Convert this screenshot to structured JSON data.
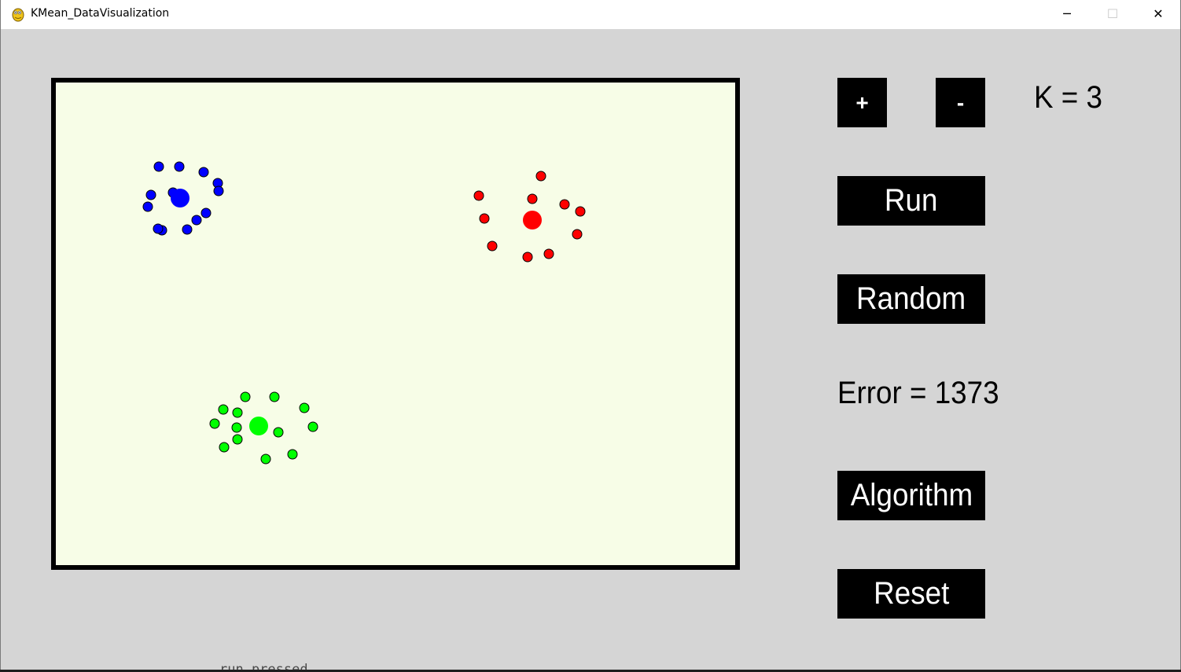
{
  "window": {
    "title": "KMean_DataVisualization",
    "minimize_glyph": "─",
    "maximize_glyph": "☐",
    "close_glyph": "✕",
    "app_icon": "pygame-snake-icon"
  },
  "controls": {
    "plus_label": "+",
    "minus_label": "-",
    "k_text": "K = 3",
    "run_label": "Run",
    "random_label": "Random",
    "error_text": "Error = 1373",
    "algorithm_label": "Algorithm",
    "reset_label": "Reset"
  },
  "console": {
    "text": "run pressed"
  },
  "colors": {
    "background": "#d5d5d5",
    "canvas": "#f7fde7",
    "button": "#000000",
    "button_text": "#ffffff",
    "cluster_blue": "#0000ff",
    "cluster_red": "#ff0000",
    "cluster_green": "#00ff00"
  },
  "clusters": [
    {
      "name": "blue",
      "color": "#0000ff",
      "centroid": [
        158,
        147
      ],
      "points": [
        [
          131,
          107
        ],
        [
          157,
          107
        ],
        [
          188,
          114
        ],
        [
          206,
          128
        ],
        [
          207,
          138
        ],
        [
          121,
          143
        ],
        [
          117,
          158
        ],
        [
          149,
          140
        ],
        [
          191,
          166
        ],
        [
          179,
          175
        ],
        [
          167,
          187
        ],
        [
          135,
          188
        ],
        [
          130,
          186
        ]
      ]
    },
    {
      "name": "red",
      "color": "#ff0000",
      "centroid": [
        606,
        175
      ],
      "points": [
        [
          617,
          119
        ],
        [
          538,
          144
        ],
        [
          606,
          148
        ],
        [
          647,
          155
        ],
        [
          667,
          164
        ],
        [
          545,
          173
        ],
        [
          663,
          193
        ],
        [
          555,
          208
        ],
        [
          600,
          222
        ],
        [
          627,
          218
        ]
      ]
    },
    {
      "name": "green",
      "color": "#00ff00",
      "centroid": [
        258,
        437
      ],
      "points": [
        [
          241,
          400
        ],
        [
          278,
          400
        ],
        [
          213,
          416
        ],
        [
          231,
          420
        ],
        [
          316,
          414
        ],
        [
          202,
          434
        ],
        [
          230,
          439
        ],
        [
          327,
          438
        ],
        [
          283,
          445
        ],
        [
          231,
          454
        ],
        [
          214,
          464
        ],
        [
          301,
          473
        ],
        [
          267,
          479
        ]
      ]
    }
  ]
}
